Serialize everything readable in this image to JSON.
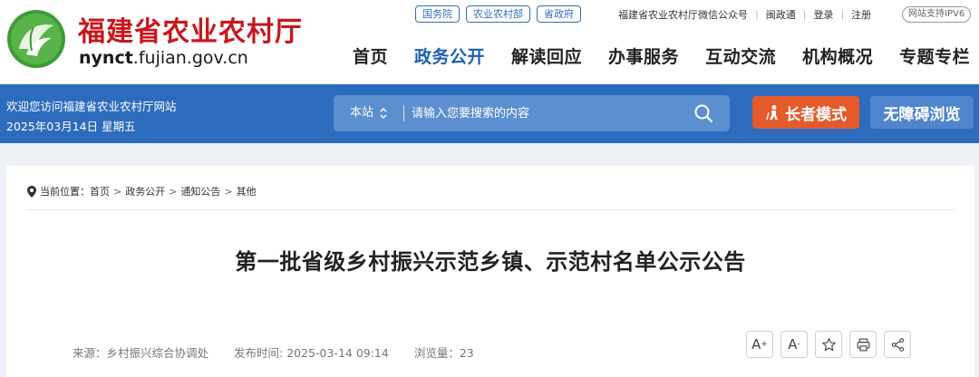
{
  "header": {
    "title": "福建省农业农村厅",
    "domain_bold": "nynct",
    "domain_rest": ".fujian.gov.cn",
    "ext_links": [
      "国务院",
      "农业农村部",
      "省政府"
    ],
    "top_links": [
      "福建省农业农村厅微信公众号",
      "闽政通",
      "登录",
      "注册"
    ],
    "ipv6": "网站支持IPV6",
    "nav": [
      "首页",
      "政务公开",
      "解读回应",
      "办事服务",
      "互动交流",
      "机构概况",
      "专题专栏"
    ],
    "nav_active": "政务公开"
  },
  "bluebar": {
    "welcome": "欢迎您访问福建省农业农村厅网站",
    "date": "2025年03月14日 星期五",
    "search_scope": "本站",
    "search_placeholder": "请输入您要搜索的内容",
    "elder_label": "长者模式",
    "access_label": "无障碍浏览"
  },
  "breadcrumb": {
    "prefix": "当前位置：",
    "items": [
      "首页",
      "政务公开",
      "通知公告",
      "其他"
    ]
  },
  "article": {
    "title": "第一批省级乡村振兴示范乡镇、示范村名单公示公告",
    "source": "来源：乡村振兴综合协调处",
    "published": "发布时间: 2025-03-14 09:14",
    "views": "浏览量：23"
  },
  "tools": {
    "font_up": "A",
    "font_down": "A",
    "font_up_sign": "+",
    "font_down_sign": "-"
  },
  "colors": {
    "brand_red": "#c8161d",
    "nav_blue": "#1d5fb0",
    "bar_blue": "#2d6cbd",
    "elder_orange": "#e55a2b"
  },
  "icons": [
    "logo-icon",
    "chevron-updown-icon",
    "search-icon",
    "elder-icon",
    "location-pin-icon",
    "star-icon",
    "print-icon",
    "share-icon"
  ]
}
